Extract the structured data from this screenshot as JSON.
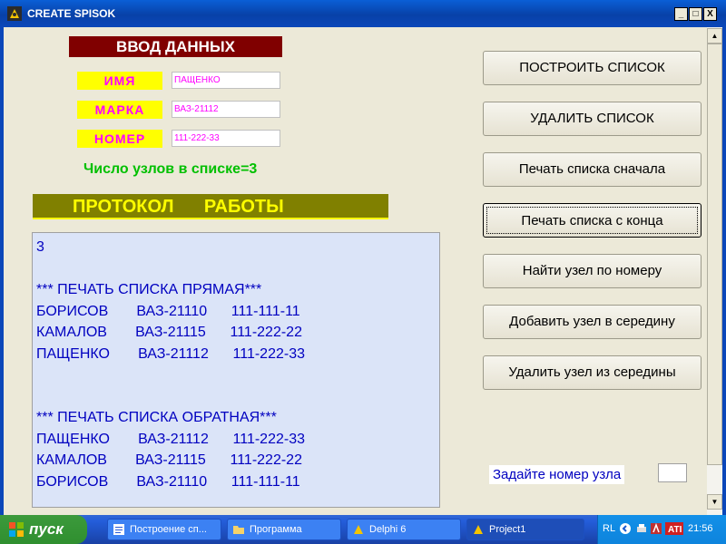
{
  "window": {
    "title": "CREATE SPISOK",
    "btn_min": "_",
    "btn_max": "□",
    "btn_close": "X"
  },
  "form": {
    "header": "ВВОД ДАННЫХ",
    "fields": [
      {
        "label": "ИМЯ",
        "value": "ПАЩЕНКО"
      },
      {
        "label": "МАРКА",
        "value": "ВАЗ-21112"
      },
      {
        "label": "НОМЕР",
        "value": "111-222-33"
      }
    ],
    "node_count": "Число узлов в списке=3",
    "protocol": "ПРОТОКОЛ      РАБОТЫ"
  },
  "log": {
    "lines": [
      "3",
      "",
      "*** ПЕЧАТЬ СПИСКА ПРЯМАЯ***",
      "БОРИСОВ       ВАЗ-21110      111-111-11",
      "КАМАЛОВ       ВАЗ-21115      111-222-22",
      "ПАЩЕНКО       ВАЗ-21112      111-222-33",
      "",
      "",
      "*** ПЕЧАТЬ СПИСКА ОБРАТНАЯ***",
      "ПАЩЕНКО       ВАЗ-21112      111-222-33",
      "КАМАЛОВ       ВАЗ-21115      111-222-22",
      "БОРИСОВ       ВАЗ-21110      111-111-11"
    ]
  },
  "buttons": [
    {
      "label": "ПОСТРОИТЬ СПИСОК"
    },
    {
      "label": "УДАЛИТЬ СПИСОК"
    },
    {
      "label": "Печать списка сначала"
    },
    {
      "label": "Печать списка с конца"
    },
    {
      "label": "Найти узел по номеру"
    },
    {
      "label": "Добавить узел в середину"
    },
    {
      "label": "Удалить узел из середины"
    }
  ],
  "node_prompt": "Задайте номер узла",
  "taskbar": {
    "start": "пуск",
    "tasks": [
      {
        "label": "Построение сп...",
        "icon": "word-icon"
      },
      {
        "label": "Программа",
        "icon": "folder-icon"
      },
      {
        "label": "Delphi 6",
        "icon": "delphi-icon"
      },
      {
        "label": "Project1",
        "icon": "delphi-icon"
      }
    ],
    "lang": "RL",
    "clock": "21:56"
  }
}
